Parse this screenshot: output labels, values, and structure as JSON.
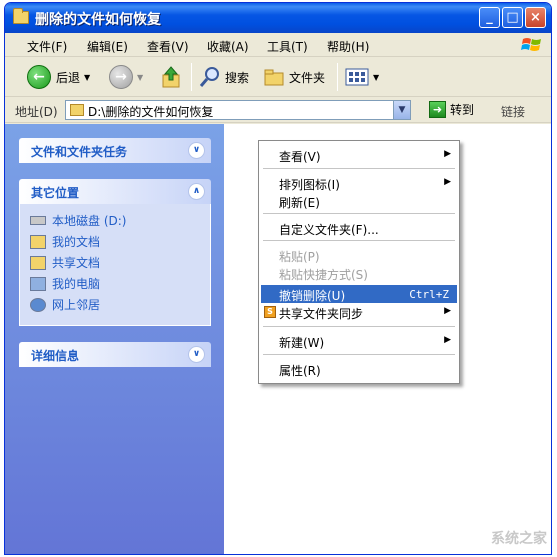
{
  "window": {
    "title": "删除的文件如何恢复",
    "buttons": {
      "minimize": "_",
      "maximize": "□",
      "close": "×"
    }
  },
  "menubar": {
    "items": [
      "文件(F)",
      "编辑(E)",
      "查看(V)",
      "收藏(A)",
      "工具(T)",
      "帮助(H)"
    ]
  },
  "toolbar": {
    "back_label": "后退",
    "search_label": "搜索",
    "folders_label": "文件夹"
  },
  "address": {
    "label": "地址(D)",
    "value": "D:\\删除的文件如何恢复",
    "go_label": "转到",
    "links_label": "链接"
  },
  "sidebar": {
    "tasks_title": "文件和文件夹任务",
    "other_title": "其它位置",
    "other_items": [
      "本地磁盘 (D:)",
      "我的文档",
      "共享文档",
      "我的电脑",
      "网上邻居"
    ],
    "details_title": "详细信息"
  },
  "context_menu": {
    "view": "查看(V)",
    "arrange": "排列图标(I)",
    "refresh": "刷新(E)",
    "customize": "自定义文件夹(F)...",
    "paste": "粘贴(P)",
    "paste_shortcut": "粘贴快捷方式(S)",
    "undo_delete": "撤销删除(U)",
    "undo_shortcut": "Ctrl+Z",
    "sync": "共享文件夹同步",
    "new": "新建(W)",
    "properties": "属性(R)"
  },
  "watermark": "系统之家",
  "colors": {
    "title_blue": "#0050e0",
    "sidebar_blue": "#7ba2e7",
    "highlight": "#316ac5"
  }
}
